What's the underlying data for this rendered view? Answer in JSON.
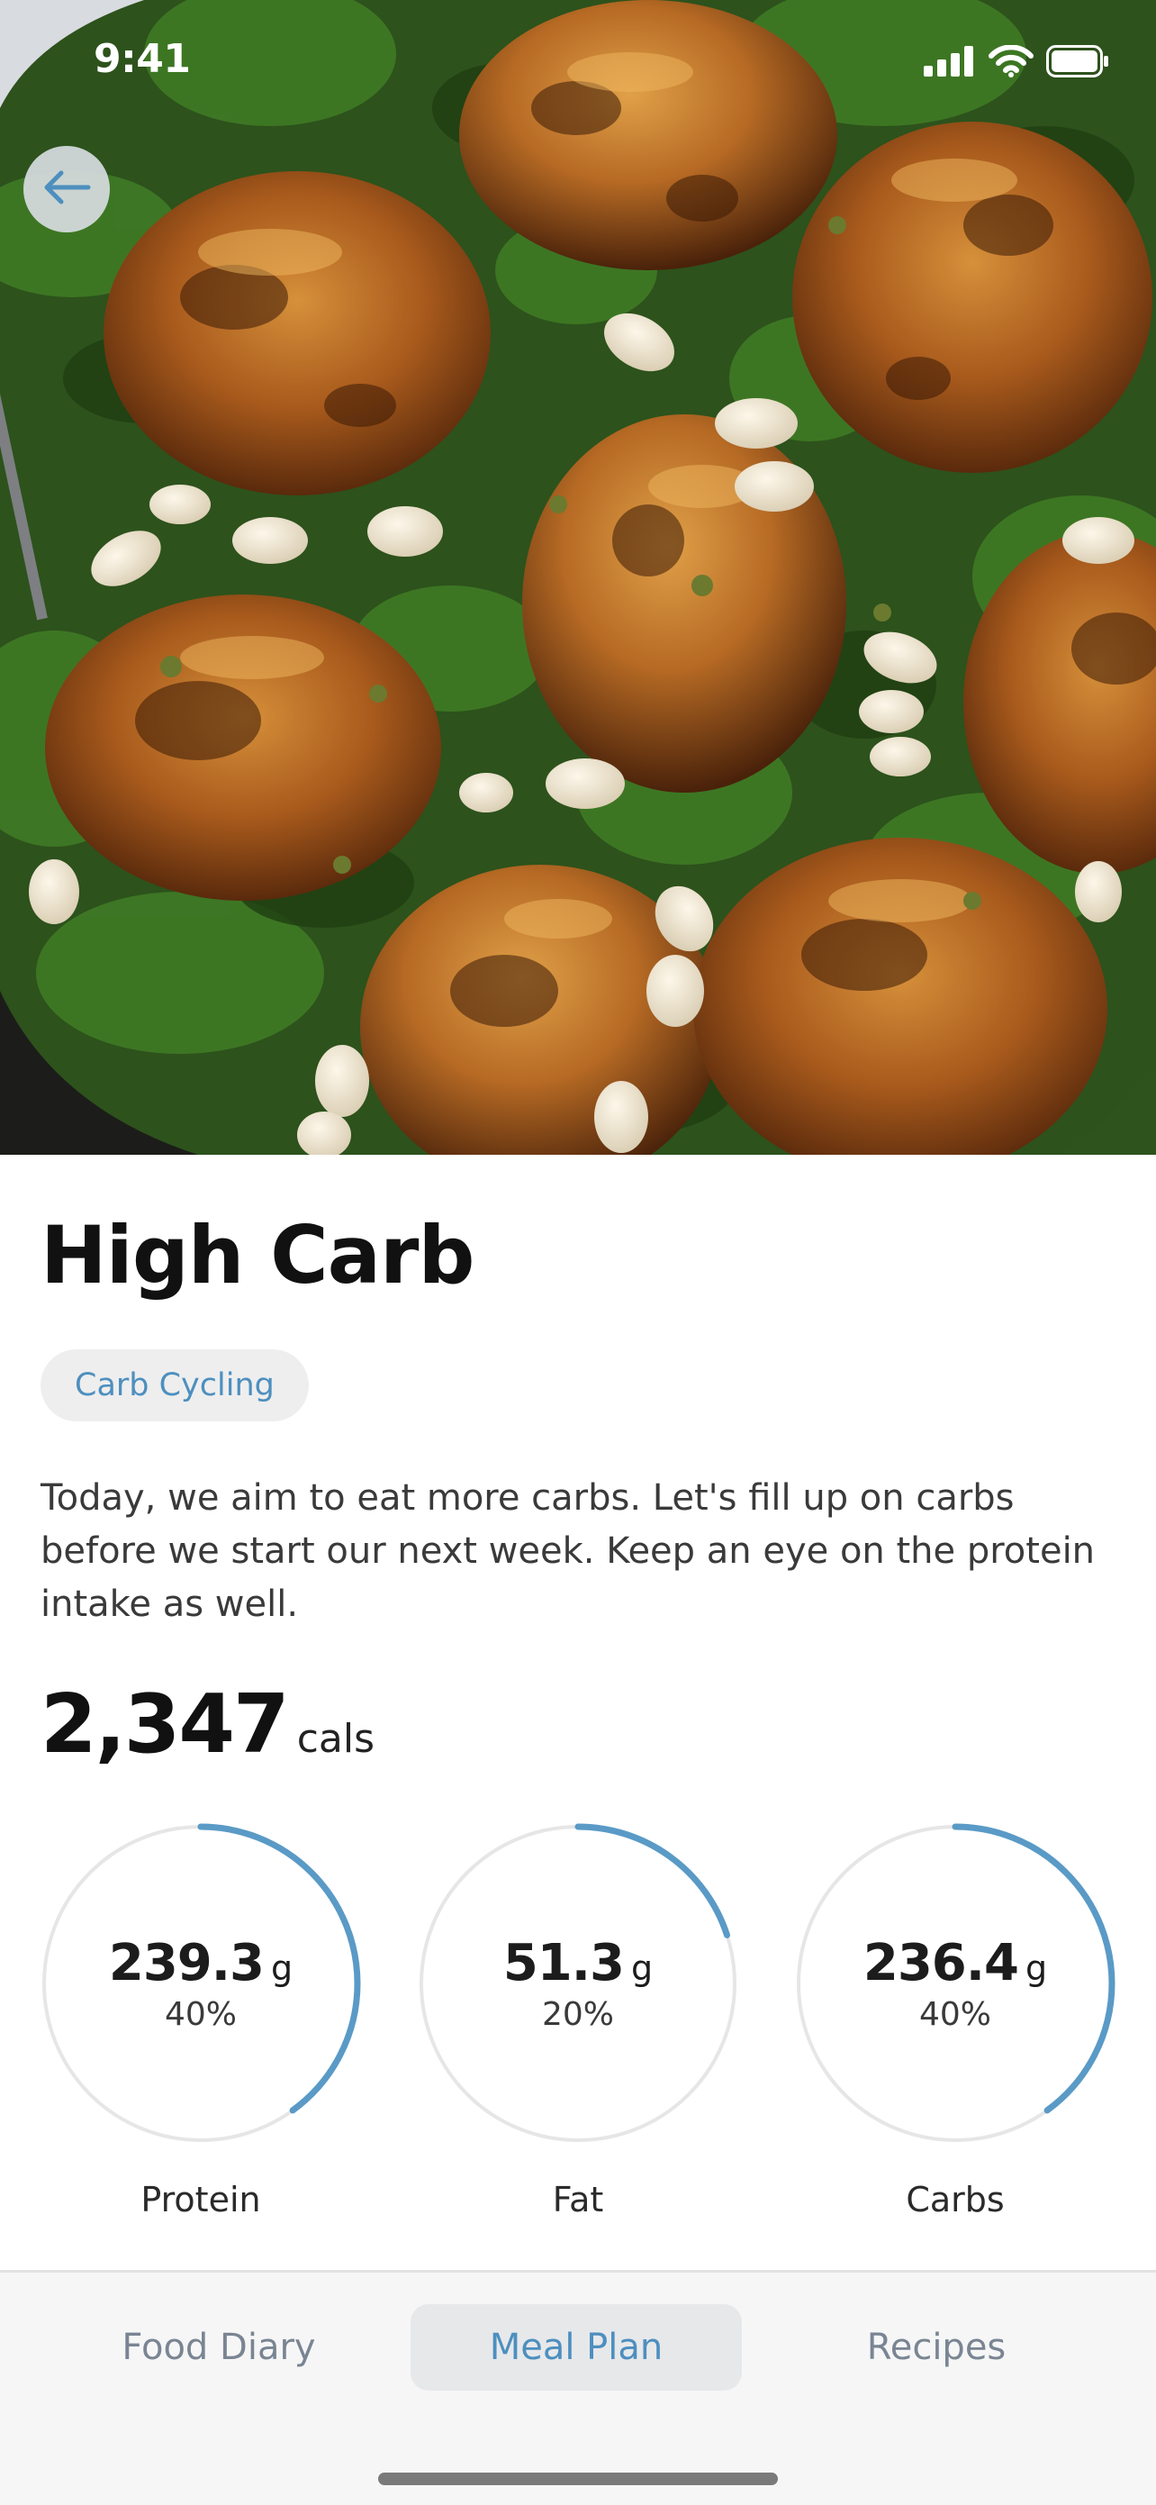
{
  "status_bar": {
    "time": "9:41",
    "icons": [
      "cellular-signal-icon",
      "wifi-icon",
      "battery-icon"
    ]
  },
  "hero": {
    "image_alt": "roasted chicken thighs with kale and white beans in a skillet"
  },
  "header": {
    "back_icon": "arrow-left-icon"
  },
  "meal": {
    "title": "High Carb",
    "tag": "Carb Cycling",
    "description": "Today, we aim to eat more carbs. Let's fill up on carbs before we start our next week. Keep an eye on the protein intake as well.",
    "calories": {
      "value": "2,347",
      "unit": "cals"
    },
    "macros": [
      {
        "name": "Protein",
        "grams": "239.3",
        "unit": "g",
        "percent": "40%",
        "fraction": 0.4
      },
      {
        "name": "Fat",
        "grams": "51.3",
        "unit": "g",
        "percent": "20%",
        "fraction": 0.2
      },
      {
        "name": "Carbs",
        "grams": "236.4",
        "unit": "g",
        "percent": "40%",
        "fraction": 0.4
      }
    ]
  },
  "tab_bar": {
    "tabs": [
      {
        "label": "Food Diary",
        "active": false
      },
      {
        "label": "Meal Plan",
        "active": true
      },
      {
        "label": "Recipes",
        "active": false
      }
    ]
  },
  "colors": {
    "accent": "#5a9ac6",
    "ring_track": "#e6e6e6",
    "tag_background": "#eeeeee",
    "tab_inactive": "#7a8593"
  }
}
